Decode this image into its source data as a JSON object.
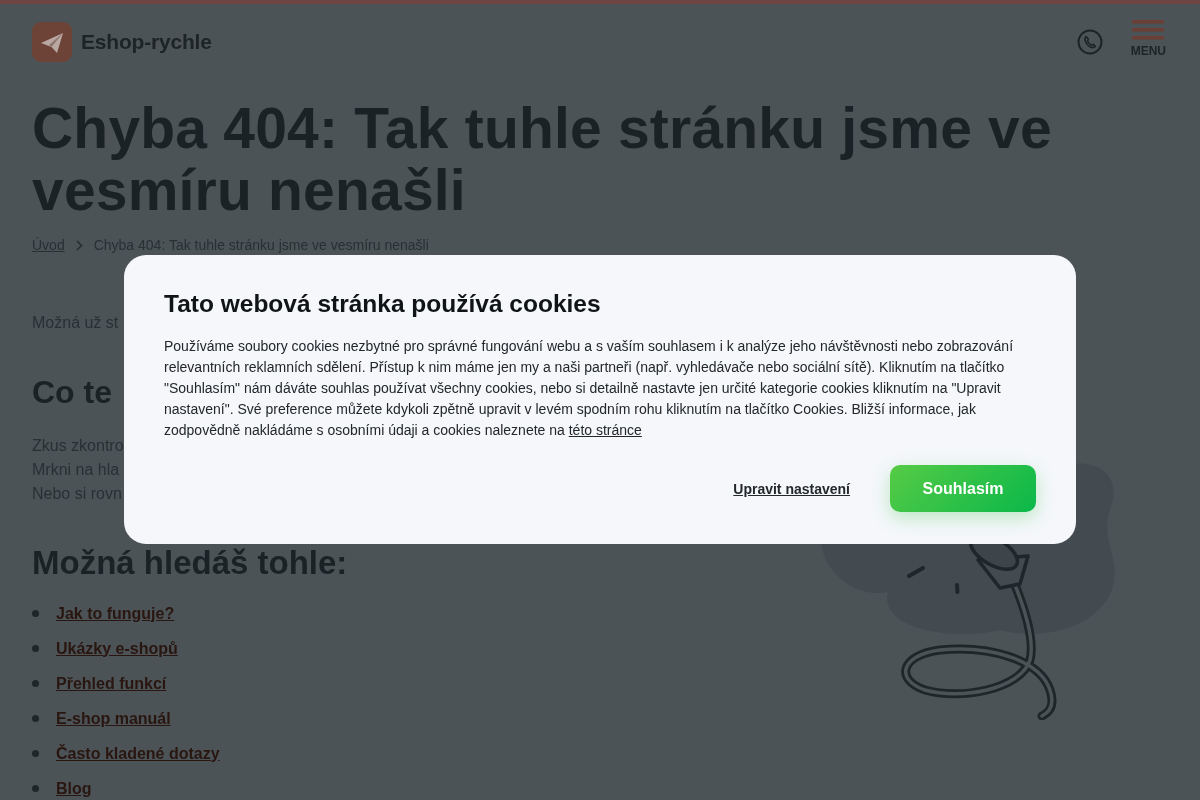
{
  "header": {
    "logo_text": "Eshop-rychle",
    "menu_label": "MENU"
  },
  "page": {
    "title": "Chyba 404: Tak tuhle stránku jsme ve vesmíru nenašli",
    "breadcrumb": [
      {
        "label": "Úvod",
        "current": false
      },
      {
        "label": "Chyba 404: Tak tuhle stránku jsme ve vesmíru nenašli",
        "current": true
      }
    ],
    "intro": "Možná už st",
    "section_heading": "Co te",
    "lines": [
      "Zkus zkontro",
      "Mrkni na hla",
      "Nebo si rovn"
    ],
    "suggestions_heading": "Možná hledáš tohle:",
    "suggestions": [
      "Jak to funguje?",
      "Ukázky e-shopů",
      "Přehled funkcí",
      "E-shop manuál",
      "Často kladené dotazy",
      "Blog"
    ]
  },
  "cookie_dialog": {
    "title": "Tato webová stránka používá cookies",
    "text": "Používáme soubory cookies nezbytné pro správné fungování webu a s vaším souhlasem i k analýze jeho návštěvnosti nebo zobrazování relevantních reklamních sdělení. Přístup k nim máme jen my a naši partneři (např. vyhledávače nebo sociální sítě). Kliknutím na tlačítko \"Souhlasím\" nám dáváte souhlas používat všechny cookies, nebo si detailně nastavte jen určité kategorie cookies kliknutím na \"Upravit nastavení\". Své preference můžete kdykoli zpětně upravit v levém spodním rohu kliknutím na tlačítko Cookies. Bližší informace, jak zodpovědně nakládáme s osobními údaji a cookies naleznete na",
    "link": "této stránce",
    "buttons": [
      {
        "label": "Upravit nastavení",
        "kind": "link"
      },
      {
        "label": "Souhlasím",
        "kind": "primary"
      }
    ]
  }
}
